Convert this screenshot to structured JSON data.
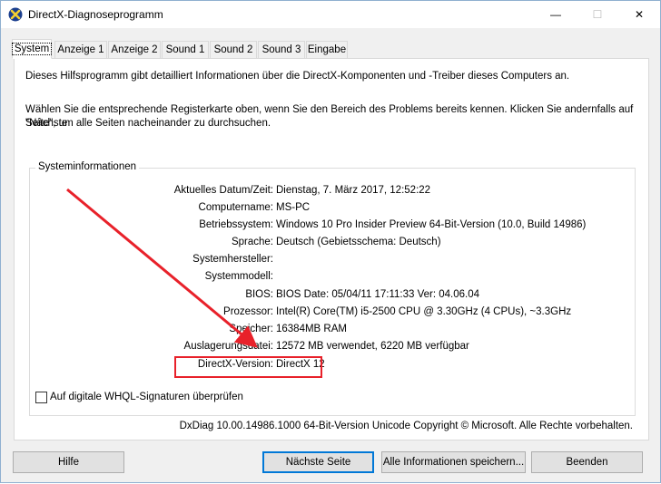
{
  "window": {
    "title": "DirectX-Diagnoseprogramm",
    "minimize_glyph": "—",
    "maximize_glyph": "☐",
    "close_glyph": "✕"
  },
  "tabs": [
    {
      "label": "System",
      "active": true
    },
    {
      "label": "Anzeige 1",
      "active": false
    },
    {
      "label": "Anzeige 2",
      "active": false
    },
    {
      "label": "Sound 1",
      "active": false
    },
    {
      "label": "Sound 2",
      "active": false
    },
    {
      "label": "Sound 3",
      "active": false
    },
    {
      "label": "Eingabe",
      "active": false
    }
  ],
  "description": {
    "line1": "Dieses Hilfsprogramm gibt detailliert Informationen über die DirectX-Komponenten und -Treiber dieses Computers an.",
    "line2": "Wählen Sie die entsprechende Registerkarte oben, wenn Sie den Bereich des Problems bereits kennen. Klicken Sie andernfalls auf \"Nächste",
    "line3": "Seite\", um alle Seiten nacheinander zu durchsuchen."
  },
  "system_info": {
    "group_title": "Systeminformationen",
    "rows": [
      {
        "label": "Aktuelles Datum/Zeit:",
        "value": "Dienstag, 7. März 2017, 12:52:22"
      },
      {
        "label": "Computername:",
        "value": "MS-PC"
      },
      {
        "label": "Betriebssystem:",
        "value": "Windows 10 Pro Insider Preview 64-Bit-Version (10.0, Build 14986)"
      },
      {
        "label": "Sprache:",
        "value": "Deutsch (Gebietsschema: Deutsch)"
      },
      {
        "label": "Systemhersteller:",
        "value": ""
      },
      {
        "label": "Systemmodell:",
        "value": ""
      },
      {
        "label": "BIOS:",
        "value": "BIOS Date: 05/04/11 17:11:33 Ver: 04.06.04"
      },
      {
        "label": "Prozessor:",
        "value": "Intel(R) Core(TM) i5-2500 CPU @ 3.30GHz (4 CPUs), ~3.3GHz"
      },
      {
        "label": "Speicher:",
        "value": "16384MB RAM"
      },
      {
        "label": "Auslagerungsdatei:",
        "value": "12572 MB verwendet, 6220 MB verfügbar"
      },
      {
        "label": "DirectX-Version:",
        "value": "DirectX 12"
      }
    ]
  },
  "checkbox": {
    "label": "Auf digitale WHQL-Signaturen überprüfen",
    "checked": false
  },
  "footer": "DxDiag 10.00.14986.1000 64-Bit-Version Unicode Copyright © Microsoft. Alle Rechte vorbehalten.",
  "buttons": {
    "help": "Hilfe",
    "next": "Nächste Seite",
    "save": "Alle Informationen speichern...",
    "exit": "Beenden"
  },
  "colors": {
    "annotation": "#e8212a",
    "default_button_border": "#0078d7"
  }
}
